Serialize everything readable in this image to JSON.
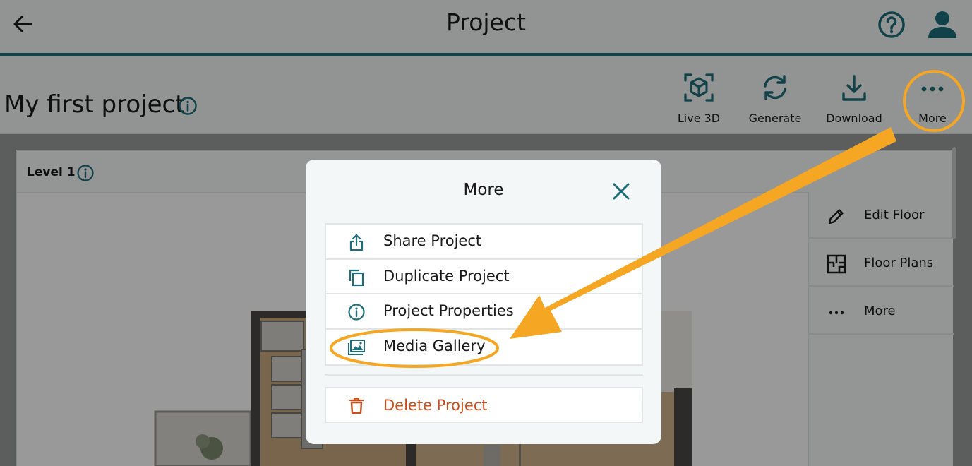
{
  "app": {
    "title": "Project"
  },
  "project": {
    "title": "My first project"
  },
  "toolbar": {
    "live3d_label": "Live 3D",
    "generate_label": "Generate",
    "download_label": "Download",
    "more_label": "More"
  },
  "level": {
    "label": "Level 1"
  },
  "side_panel": {
    "items": [
      {
        "label": "Edit Floor",
        "icon": "pencil-icon"
      },
      {
        "label": "Floor Plans",
        "icon": "floor-plan-icon"
      },
      {
        "label": "More",
        "icon": "ellipsis-icon"
      }
    ]
  },
  "modal": {
    "title": "More",
    "items": [
      {
        "label": "Share Project",
        "icon": "share-icon"
      },
      {
        "label": "Duplicate Project",
        "icon": "duplicate-icon"
      },
      {
        "label": "Project Properties",
        "icon": "info-icon"
      },
      {
        "label": "Media Gallery",
        "icon": "gallery-icon"
      }
    ],
    "delete_label": "Delete Project"
  },
  "colors": {
    "accent": "#1d6e7a",
    "danger": "#c4501f",
    "annotation": "#f5a623"
  }
}
